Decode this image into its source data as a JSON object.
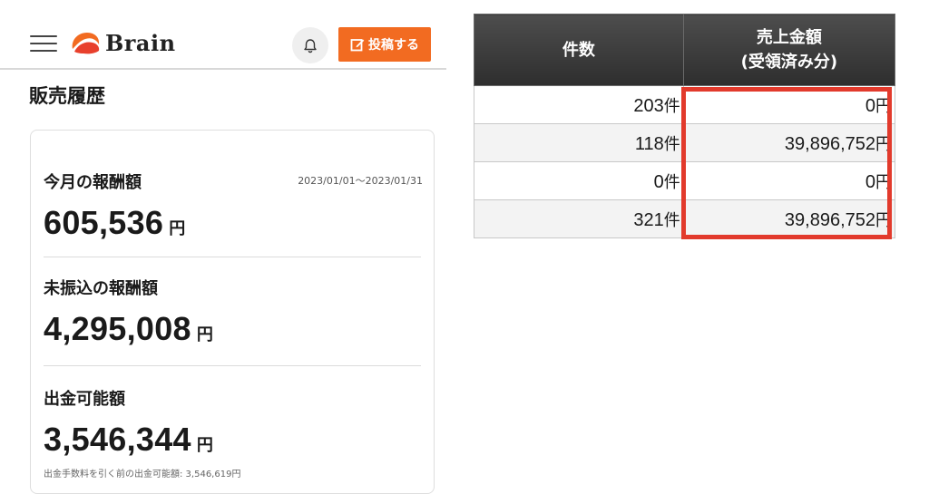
{
  "header": {
    "brand": "Brain",
    "post_button_label": "投稿する",
    "brand_colors": {
      "accent": "#f26b21",
      "logo_orange": "#f26b21",
      "logo_red": "#e8402c"
    }
  },
  "page": {
    "title": "販売履歴"
  },
  "summary": {
    "monthly_reward": {
      "label": "今月の報酬額",
      "date_range": "2023/01/01〜2023/01/31",
      "amount": "605,536",
      "unit": "円"
    },
    "untransferred_reward": {
      "label": "未振込の報酬額",
      "amount": "4,295,008",
      "unit": "円"
    },
    "withdrawable": {
      "label": "出金可能額",
      "amount": "3,546,344",
      "unit": "円",
      "note": "出金手数料を引く前の出金可能額: 3,546,619円"
    }
  },
  "sales_table": {
    "headers": {
      "count": "件数",
      "sales_line1": "売上金額",
      "sales_line2": "(受領済み分)"
    },
    "rows": [
      {
        "count": "203",
        "count_unit": "件",
        "sales": "0",
        "sales_unit": "円"
      },
      {
        "count": "118",
        "count_unit": "件",
        "sales": "39,896,752",
        "sales_unit": "円"
      },
      {
        "count": "0",
        "count_unit": "件",
        "sales": "0",
        "sales_unit": "円"
      },
      {
        "count": "321",
        "count_unit": "件",
        "sales": "39,896,752",
        "sales_unit": "円"
      }
    ],
    "highlight_color": "#e23a2c"
  }
}
